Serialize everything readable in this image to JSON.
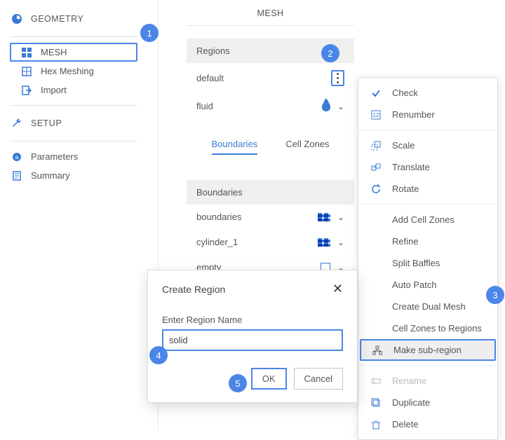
{
  "sidebar": {
    "geometry": {
      "label": "GEOMETRY"
    },
    "mesh": {
      "label": "MESH",
      "children": {
        "mesh": "MESH",
        "hex": "Hex Meshing",
        "import": "Import"
      }
    },
    "setup": {
      "label": "SETUP"
    },
    "parameters": "Parameters",
    "summary": "Summary"
  },
  "panel": {
    "title": "MESH",
    "regions_head": "Regions",
    "region_default": "default",
    "region_fluid": "fluid",
    "tabs": {
      "boundaries": "Boundaries",
      "cellzones": "Cell Zones"
    },
    "boundaries_head": "Boundaries",
    "row_boundaries": "boundaries",
    "row_cylinder": "cylinder_1",
    "row_empty": "empty"
  },
  "menu": {
    "check": "Check",
    "renumber": "Renumber",
    "scale": "Scale",
    "translate": "Translate",
    "rotate": "Rotate",
    "addcell": "Add Cell Zones",
    "refine": "Refine",
    "split": "Split Baffles",
    "autopatch": "Auto Patch",
    "dualmesh": "Create Dual Mesh",
    "cz2r": "Cell Zones to Regions",
    "subregion": "Make sub-region",
    "rename": "Rename",
    "duplicate": "Duplicate",
    "delete": "Delete"
  },
  "dialog": {
    "title": "Create Region",
    "label": "Enter Region Name",
    "value": "solid",
    "ok": "OK",
    "cancel": "Cancel"
  },
  "callouts": {
    "c1": "1",
    "c2": "2",
    "c3": "3",
    "c4": "4",
    "c5": "5"
  }
}
